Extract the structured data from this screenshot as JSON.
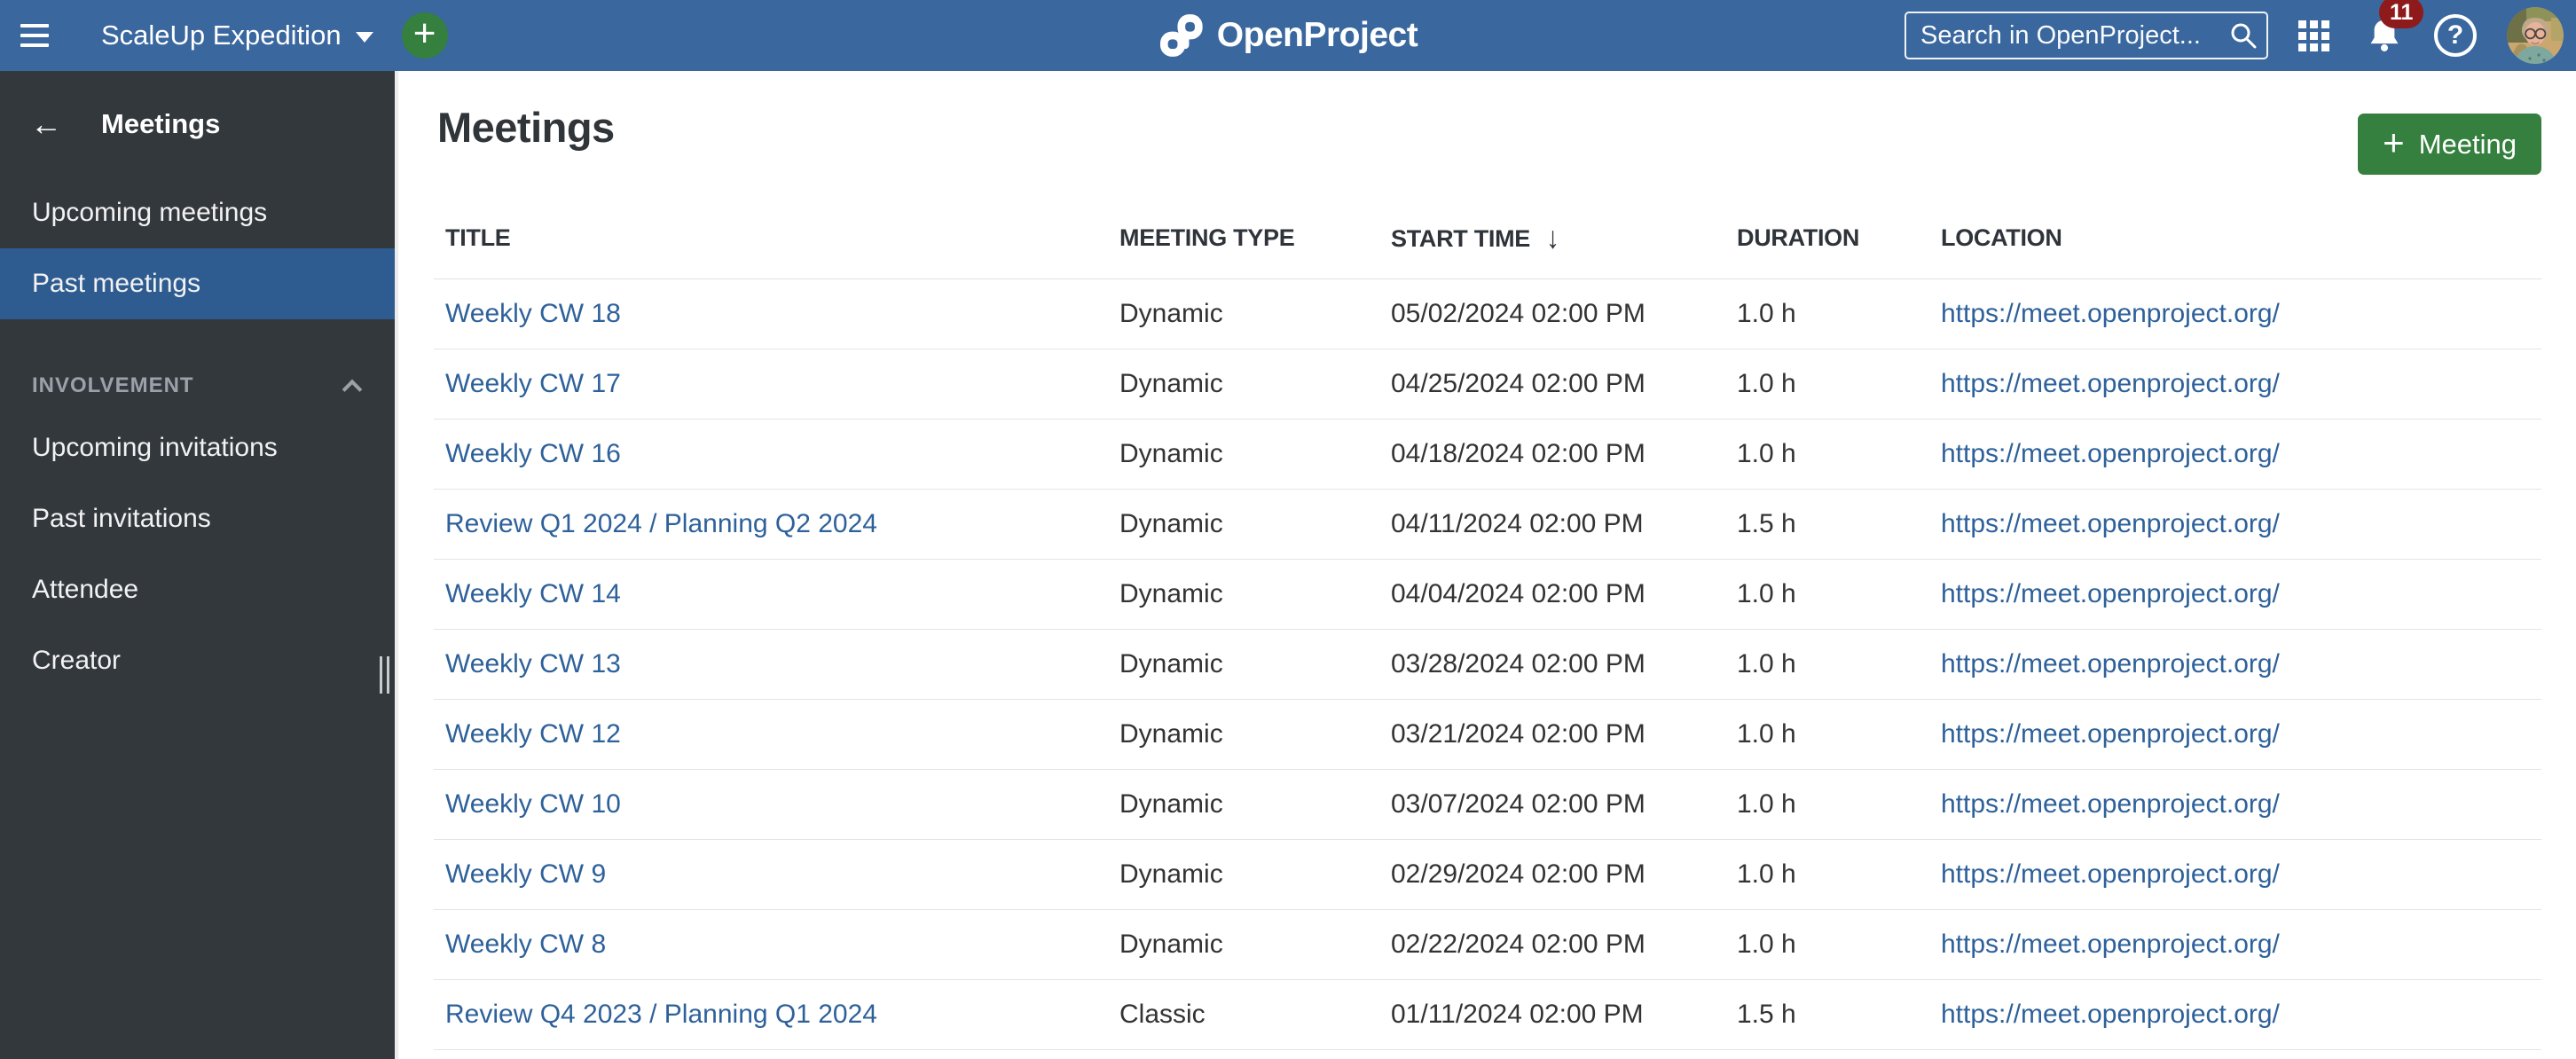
{
  "topbar": {
    "project_name": "ScaleUp Expedition",
    "quick_add_label": "+",
    "logo_text": "OpenProject",
    "search_placeholder": "Search in OpenProject...",
    "notification_count": "11",
    "help_label": "?"
  },
  "sidebar": {
    "back_label": "←",
    "title": "Meetings",
    "items": [
      {
        "label": "Upcoming meetings",
        "active": false
      },
      {
        "label": "Past meetings",
        "active": true
      }
    ],
    "involvement": {
      "label": "INVOLVEMENT",
      "items": [
        {
          "label": "Upcoming invitations"
        },
        {
          "label": "Past invitations"
        },
        {
          "label": "Attendee"
        },
        {
          "label": "Creator"
        }
      ]
    }
  },
  "main": {
    "title": "Meetings",
    "add_button_label": "Meeting",
    "add_button_plus": "+",
    "table": {
      "columns": {
        "title": "TITLE",
        "type": "MEETING TYPE",
        "start": "START TIME",
        "duration": "DURATION",
        "location": "LOCATION"
      },
      "sort": {
        "column": "START TIME",
        "direction": "desc",
        "arrow": "↓"
      },
      "rows": [
        {
          "title": "Weekly CW 18",
          "type": "Dynamic",
          "start": "05/02/2024 02:00 PM",
          "duration": "1.0 h",
          "location": "https://meet.openproject.org/"
        },
        {
          "title": "Weekly CW 17",
          "type": "Dynamic",
          "start": "04/25/2024 02:00 PM",
          "duration": "1.0 h",
          "location": "https://meet.openproject.org/"
        },
        {
          "title": "Weekly CW 16",
          "type": "Dynamic",
          "start": "04/18/2024 02:00 PM",
          "duration": "1.0 h",
          "location": "https://meet.openproject.org/"
        },
        {
          "title": "Review Q1 2024 / Planning Q2 2024",
          "type": "Dynamic",
          "start": "04/11/2024 02:00 PM",
          "duration": "1.5 h",
          "location": "https://meet.openproject.org/"
        },
        {
          "title": "Weekly CW 14",
          "type": "Dynamic",
          "start": "04/04/2024 02:00 PM",
          "duration": "1.0 h",
          "location": "https://meet.openproject.org/"
        },
        {
          "title": "Weekly CW 13",
          "type": "Dynamic",
          "start": "03/28/2024 02:00 PM",
          "duration": "1.0 h",
          "location": "https://meet.openproject.org/"
        },
        {
          "title": "Weekly CW 12",
          "type": "Dynamic",
          "start": "03/21/2024 02:00 PM",
          "duration": "1.0 h",
          "location": "https://meet.openproject.org/"
        },
        {
          "title": "Weekly CW 10",
          "type": "Dynamic",
          "start": "03/07/2024 02:00 PM",
          "duration": "1.0 h",
          "location": "https://meet.openproject.org/"
        },
        {
          "title": "Weekly CW 9",
          "type": "Dynamic",
          "start": "02/29/2024 02:00 PM",
          "duration": "1.0 h",
          "location": "https://meet.openproject.org/"
        },
        {
          "title": "Weekly CW 8",
          "type": "Dynamic",
          "start": "02/22/2024 02:00 PM",
          "duration": "1.0 h",
          "location": "https://meet.openproject.org/"
        },
        {
          "title": "Review Q4 2023 / Planning Q1 2024",
          "type": "Classic",
          "start": "01/11/2024 02:00 PM",
          "duration": "1.5 h",
          "location": "https://meet.openproject.org/"
        }
      ]
    }
  },
  "colors": {
    "topbar_bg": "#39679E",
    "sidebar_bg": "#33383D",
    "active_item_bg": "#2E5C90",
    "accent_green": "#35803E",
    "link_blue": "#2E619A",
    "badge_red": "#8F1A1C",
    "section_label_gray": "#9AA1A8"
  }
}
